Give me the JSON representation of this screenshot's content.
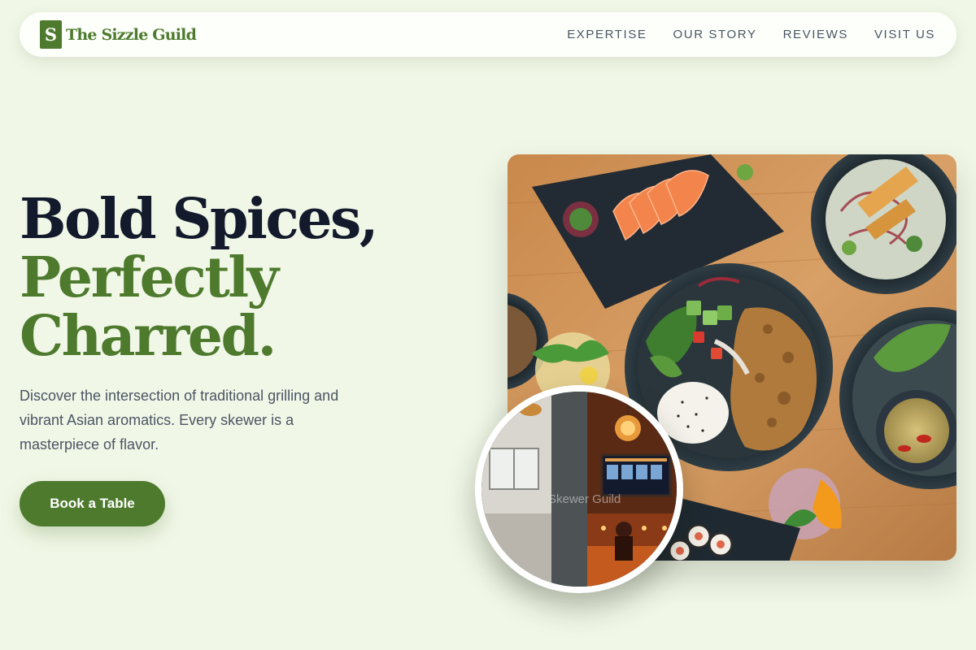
{
  "nav": {
    "logo_letter": "S",
    "brand": "The Sizzle Guild",
    "links": [
      "EXPERTISE",
      "OUR STORY",
      "REVIEWS",
      "VISIT US"
    ]
  },
  "hero": {
    "title_line1": "Bold Spices,",
    "title_line2": "Perfectly",
    "title_line3": "Charred.",
    "description": "Discover the intersection of traditional grilling and vibrant Asian aromatics. Every skewer is a masterpiece of flavor.",
    "cta_label": "Book a Table"
  },
  "images": {
    "interior_alt_fragment": "Skewer Guild"
  },
  "colors": {
    "page_background": "#f1f7e7",
    "brand_green": "#4e7a2e",
    "heading_dark": "#121a2c",
    "body_text": "#4b5563",
    "nav_background": "#fcfffa"
  }
}
